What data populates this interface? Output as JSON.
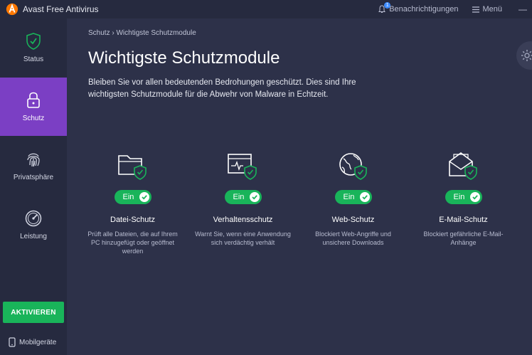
{
  "window": {
    "title": "Avast Free Antivirus"
  },
  "titlebar": {
    "notifications_label": "Benachrichtigungen",
    "notifications_count": "1",
    "menu_label": "Menü",
    "minimize_glyph": "—"
  },
  "sidebar": {
    "items": [
      {
        "label": "Status",
        "icon": "shield-check-icon"
      },
      {
        "label": "Schutz",
        "icon": "lock-icon"
      },
      {
        "label": "Privatsphäre",
        "icon": "fingerprint-icon"
      },
      {
        "label": "Leistung",
        "icon": "speedometer-icon"
      }
    ],
    "active": "Schutz",
    "activate_label": "AKTIVIEREN",
    "mobile_label": "Mobilgeräte"
  },
  "main": {
    "breadcrumb": {
      "parent": "Schutz",
      "separator": "›",
      "current": "Wichtigste Schutzmodule"
    },
    "title": "Wichtigste Schutzmodule",
    "description": "Bleiben Sie vor allen bedeutenden Bedrohungen geschützt. Dies sind Ihre wichtigsten Schutzmodule für die Abwehr von Malware in Echtzeit.",
    "modules": [
      {
        "name": "Datei-Schutz",
        "toggle": "Ein",
        "description": "Prüft alle Dateien, die auf Ihrem PC hinzugefügt oder geöffnet werden",
        "icon": "folder-shield-icon"
      },
      {
        "name": "Verhaltensschutz",
        "toggle": "Ein",
        "description": "Warnt Sie, wenn eine Anwendung sich verdächtig verhält",
        "icon": "monitor-shield-icon"
      },
      {
        "name": "Web-Schutz",
        "toggle": "Ein",
        "description": "Blockiert Web-Angriffe und unsichere Downloads",
        "icon": "globe-shield-icon"
      },
      {
        "name": "E-Mail-Schutz",
        "toggle": "Ein",
        "description": "Blockiert gefährliche E-Mail-Anhänge",
        "icon": "envelope-shield-icon"
      }
    ]
  },
  "colors": {
    "accent": "#7b3fc4",
    "success": "#19b45a",
    "background": "#2d3149",
    "sidebar": "#262a3f"
  }
}
